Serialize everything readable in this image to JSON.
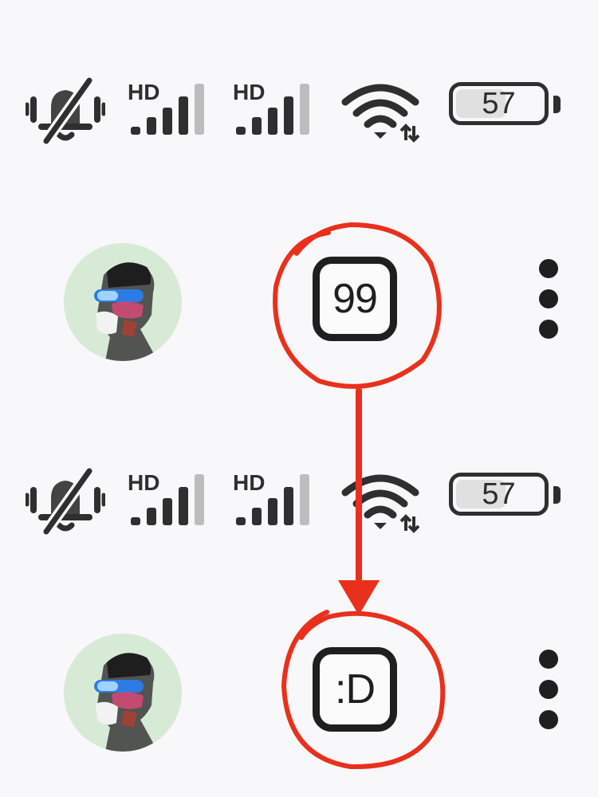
{
  "status_top": {
    "icons": [
      "bell-muted-vibrate-icon",
      "signal-hd-icon",
      "signal-hd-icon",
      "wifi-icon",
      "battery-icon"
    ],
    "hd_label_1": "HD",
    "hd_label_2": "HD",
    "battery_level": "57",
    "battery_fraction": 0.57
  },
  "row_top": {
    "app_icon_text": "99",
    "more_icon": "more-vertical-icon",
    "avatar": "avatar"
  },
  "status_bottom": {
    "icons": [
      "bell-muted-vibrate-icon",
      "signal-hd-icon",
      "signal-hd-icon",
      "wifi-icon",
      "battery-icon"
    ],
    "hd_label_1": "HD",
    "hd_label_2": "HD",
    "battery_level": "57",
    "battery_fraction": 0.57
  },
  "row_bottom": {
    "app_icon_text": ":D",
    "more_icon": "more-vertical-icon",
    "avatar": "avatar"
  },
  "colors": {
    "annotation_red": "#e8301c",
    "icon_dark": "#2f2f2f",
    "background": "#f8f7f9"
  }
}
